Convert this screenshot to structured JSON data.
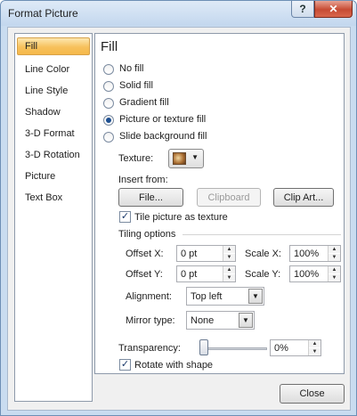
{
  "window": {
    "title": "Format Picture",
    "help_label": "?",
    "close_label": "✕"
  },
  "sidebar": {
    "items": [
      {
        "label": "Fill"
      },
      {
        "label": "Line Color"
      },
      {
        "label": "Line Style"
      },
      {
        "label": "Shadow"
      },
      {
        "label": "3-D Format"
      },
      {
        "label": "3-D Rotation"
      },
      {
        "label": "Picture"
      },
      {
        "label": "Text Box"
      }
    ],
    "selected": "Fill"
  },
  "fill": {
    "heading": "Fill",
    "options": [
      {
        "label": "No fill",
        "checked": false
      },
      {
        "label": "Solid fill",
        "checked": false
      },
      {
        "label": "Gradient fill",
        "checked": false
      },
      {
        "label": "Picture or texture fill",
        "checked": true
      },
      {
        "label": "Slide background fill",
        "checked": false
      }
    ],
    "texture_label": "Texture:",
    "insert_from_label": "Insert from:",
    "file_button": "File...",
    "clipboard_button": "Clipboard",
    "clipart_button": "Clip Art...",
    "tile_checkbox": {
      "label": "Tile picture as texture",
      "checked": true
    },
    "tiling_options_label": "Tiling options",
    "offset_x": {
      "label": "Offset X:",
      "value": "0 pt"
    },
    "offset_y": {
      "label": "Offset Y:",
      "value": "0 pt"
    },
    "scale_x": {
      "label": "Scale X:",
      "value": "100%"
    },
    "scale_y": {
      "label": "Scale Y:",
      "value": "100%"
    },
    "alignment": {
      "label": "Alignment:",
      "value": "Top left"
    },
    "mirror_type": {
      "label": "Mirror type:",
      "value": "None"
    },
    "transparency": {
      "label": "Transparency:",
      "value": "0%",
      "level": 0
    },
    "rotate_checkbox": {
      "label": "Rotate with shape",
      "checked": true
    }
  },
  "footer": {
    "close_button": "Close"
  },
  "icons": {
    "spin_up": "▲",
    "spin_down": "▼",
    "dropdown": "▼",
    "check": "✓"
  }
}
